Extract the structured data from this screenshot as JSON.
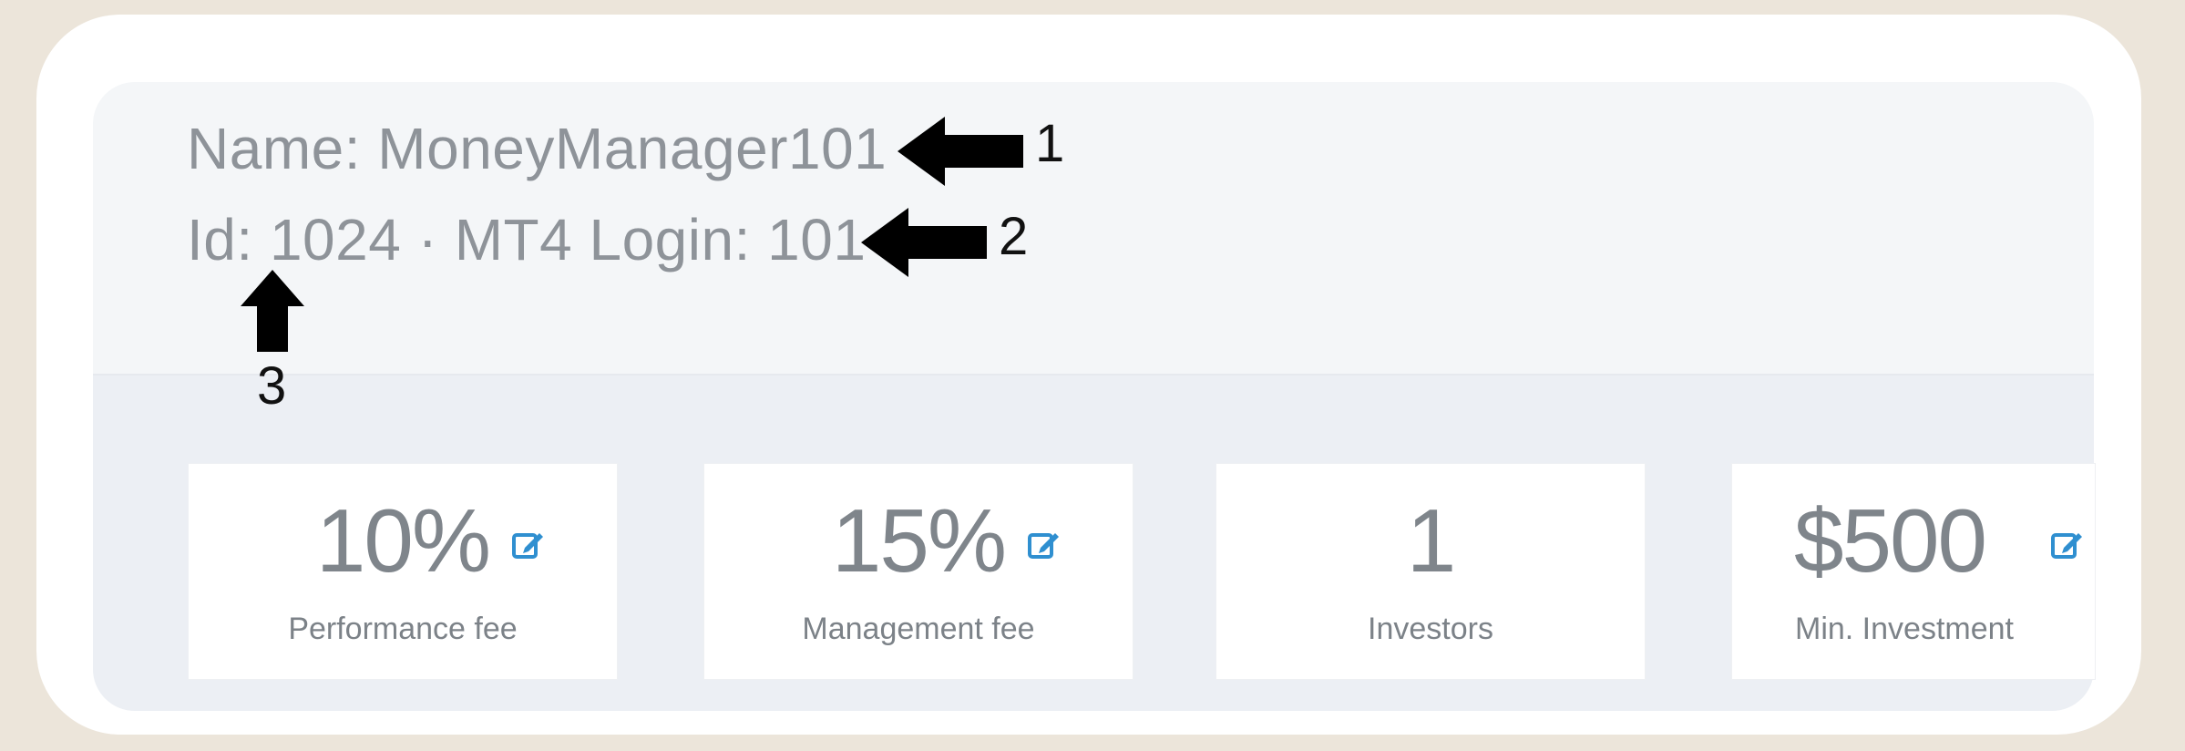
{
  "header": {
    "name_line": "Name: MoneyManager101",
    "id_line": "Id: 1024 · MT4 Login: 101"
  },
  "annotations": {
    "one": "1",
    "two": "2",
    "three": "3"
  },
  "stats": [
    {
      "value": "10%",
      "label": "Performance fee",
      "editable": true
    },
    {
      "value": "15%",
      "label": "Management fee",
      "editable": true
    },
    {
      "value": "1",
      "label": "Investors",
      "editable": false
    },
    {
      "value": "$500",
      "label": "Min. Investment",
      "editable": true
    }
  ],
  "colors": {
    "accent_icon": "#2f8fd0",
    "text_muted": "#8e9399",
    "annotation_arrow": "#000000"
  },
  "icons": {
    "edit": "edit-icon",
    "arrow": "arrow-icon"
  }
}
